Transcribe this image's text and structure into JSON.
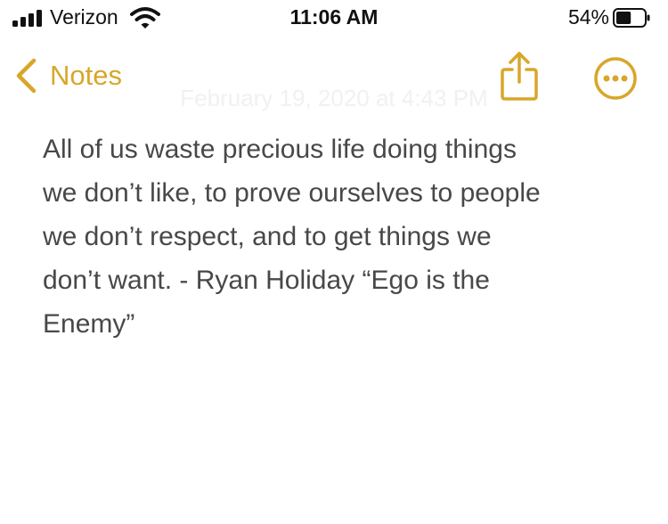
{
  "status_bar": {
    "carrier": "Verizon",
    "time": "11:06 AM",
    "battery_percent": "54%",
    "battery_level": 0.54,
    "signal_bars": 4,
    "icons": [
      "signal-bars-icon",
      "wifi-icon",
      "battery-icon"
    ]
  },
  "nav": {
    "back_label": "Notes",
    "icons": [
      "chevron-left-icon",
      "share-icon",
      "more-options-icon"
    ],
    "accent_color": "#d8a62a"
  },
  "note": {
    "date": "February 19, 2020 at 4:43 PM",
    "lines": [
      "All of us waste precious life doing things",
      "we don’t like, to prove ourselves to people",
      "we don’t respect, and to get things we",
      "don’t want. - Ryan Holiday “Ego is the",
      "Enemy”"
    ]
  }
}
